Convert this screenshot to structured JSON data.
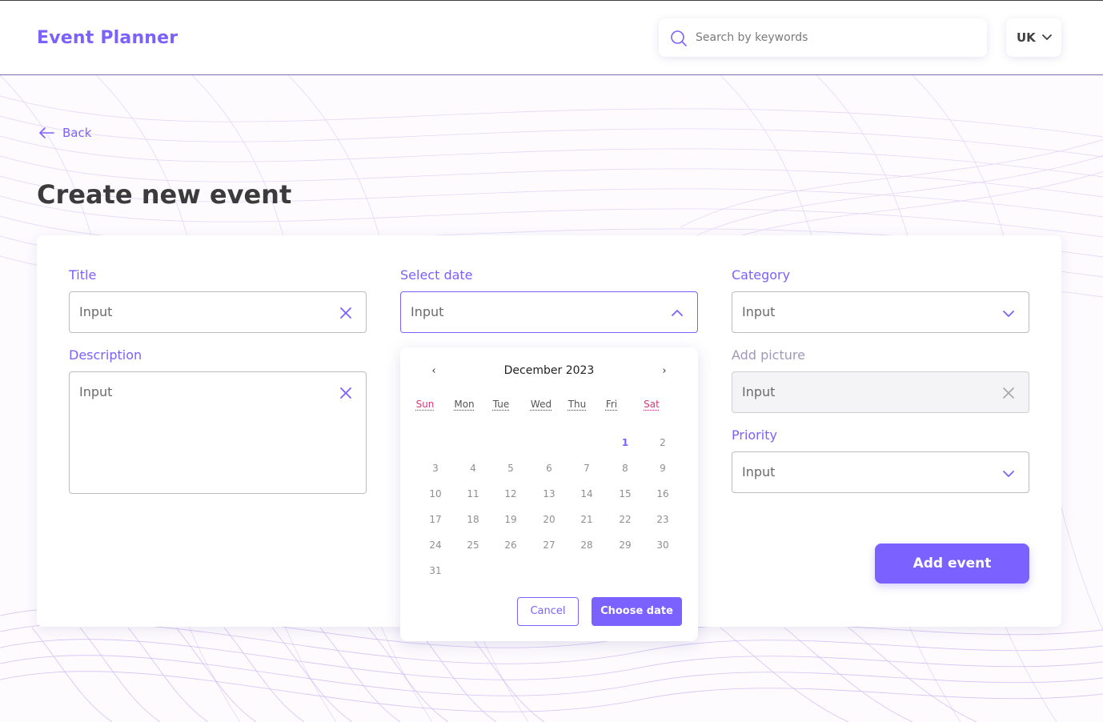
{
  "colors": {
    "accent": "#7b61ff",
    "weekend": "#d9367a",
    "heading": "#3b3b3b"
  },
  "header": {
    "logo": "Event Planner",
    "search": {
      "placeholder": "Search by keywords",
      "value": "",
      "icon": "search-icon"
    },
    "language": {
      "value": "UK",
      "icon": "chevron-down-icon"
    }
  },
  "nav": {
    "back_label": "Back",
    "back_icon": "arrow-left-icon"
  },
  "page": {
    "title": "Create new event"
  },
  "form": {
    "title": {
      "label": "Title",
      "placeholder": "Input",
      "icon": "close-icon"
    },
    "description": {
      "label": "Description",
      "placeholder": "Input",
      "icon": "close-icon"
    },
    "select_date": {
      "label": "Select date",
      "placeholder": "Input",
      "icon": "chevron-up-icon"
    },
    "category": {
      "label": "Category",
      "placeholder": "Input",
      "icon": "chevron-down-icon"
    },
    "add_picture": {
      "label": "Add picture",
      "placeholder": "Input",
      "icon": "close-icon"
    },
    "priority": {
      "label": "Priority",
      "placeholder": "Input",
      "icon": "chevron-down-icon"
    },
    "submit_label": "Add event"
  },
  "datepicker": {
    "prev": "‹",
    "next": "›",
    "month": "December 2023",
    "weekdays": [
      "Sun",
      "Mon",
      "Tue",
      "Wed",
      "Thu",
      "Fri",
      "Sat"
    ],
    "weekend_days": [
      "Sun",
      "Sat"
    ],
    "first_weekday": 5,
    "days_in_month": 31,
    "highlighted_day": 1,
    "cancel_label": "Cancel",
    "choose_label": "Choose date"
  }
}
